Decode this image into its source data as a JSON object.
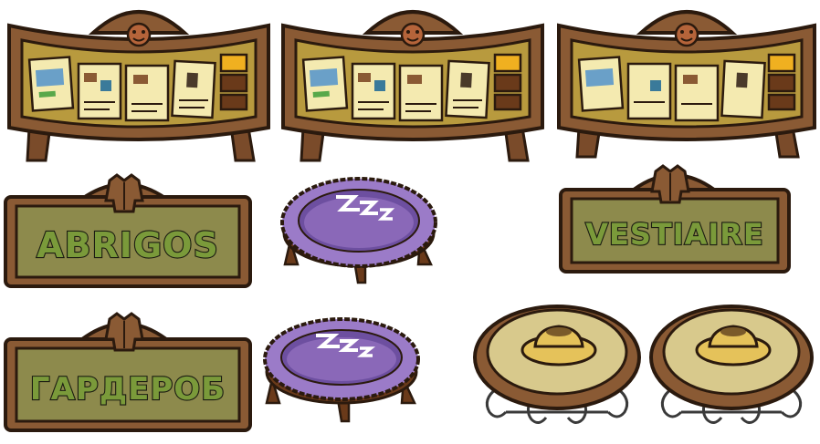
{
  "sheet": {
    "background": "#ffffff",
    "boards": [
      {
        "variant": "outlined",
        "icon": "puffle-face-icon"
      },
      {
        "variant": "outlined",
        "icon": "puffle-face-icon"
      },
      {
        "variant": "plain",
        "icon": "puffle-face-icon"
      }
    ],
    "signs": [
      {
        "text": "ABRIGOS",
        "icon": "coat-icon"
      },
      {
        "text": "VESTIAIRE",
        "icon": "coat-icon"
      },
      {
        "text": "ГАРДЕРОБ",
        "icon": "coat-icon"
      }
    ],
    "beds": [
      {
        "icon": "zzz-icon"
      },
      {
        "icon": "zzz-icon"
      }
    ],
    "tables": [
      {
        "icon": "hat-icon"
      },
      {
        "icon": "hat-icon"
      }
    ]
  },
  "colors": {
    "wood": "#8a5a34",
    "wood_dark": "#5a361c",
    "cork": "#b89a3e",
    "paper": "#f4eab0",
    "sign_panel": "#8d8a4c",
    "sign_text": "#7a9a3a",
    "bed_purple": "#9b7bc8",
    "bed_purple_dark": "#6d4fa0",
    "table_top": "#d8c98c",
    "hat": "#e5c25a"
  }
}
